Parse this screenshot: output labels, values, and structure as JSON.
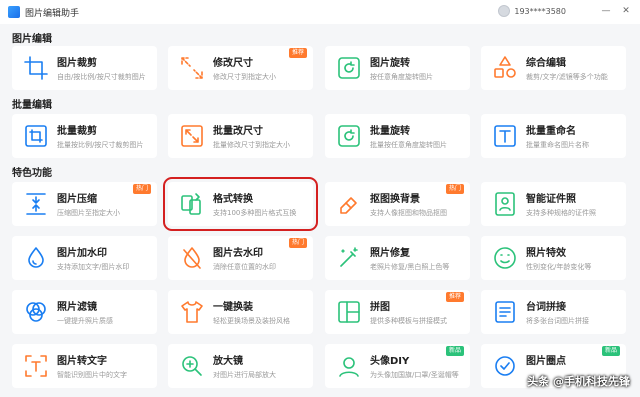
{
  "app": {
    "title": "图片编辑助手",
    "user": "193****3580"
  },
  "window": {
    "minimize": "—",
    "close": "✕"
  },
  "sections": {
    "edit": "图片编辑",
    "batch": "批量编辑",
    "features": "特色功能"
  },
  "cards": {
    "crop": {
      "name": "图片裁剪",
      "desc": "自由/按比例/按尺寸裁剪图片"
    },
    "resize": {
      "name": "修改尺寸",
      "desc": "修改尺寸到指定大小",
      "badge": "推荐"
    },
    "rotate": {
      "name": "图片旋转",
      "desc": "按任意角度旋转图片"
    },
    "combo": {
      "name": "综合编辑",
      "desc": "裁剪/文字/滤镜等多个功能"
    },
    "batch_crop": {
      "name": "批量裁剪",
      "desc": "批量按比例/按尺寸裁剪图片"
    },
    "batch_resize": {
      "name": "批量改尺寸",
      "desc": "批量修改尺寸到指定大小"
    },
    "batch_rotate": {
      "name": "批量旋转",
      "desc": "批量按任意角度旋转图片"
    },
    "batch_rename": {
      "name": "批量重命名",
      "desc": "批量重命名图片名称"
    },
    "compress": {
      "name": "图片压缩",
      "desc": "压缩图片至指定大小",
      "badge": "热门"
    },
    "convert": {
      "name": "格式转换",
      "desc": "支持100多种图片格式互换"
    },
    "matting": {
      "name": "抠图换背景",
      "desc": "支持人像抠图和物品抠图",
      "badge": "热门"
    },
    "id_photo": {
      "name": "智能证件照",
      "desc": "支持多种规格的证件照"
    },
    "watermark_add": {
      "name": "图片加水印",
      "desc": "支持添加文字/图片水印"
    },
    "watermark_remove": {
      "name": "图片去水印",
      "desc": "消除任意位置的水印",
      "badge": "热门"
    },
    "repair": {
      "name": "照片修复",
      "desc": "老照片修复/黑白照上色等"
    },
    "effects": {
      "name": "照片特效",
      "desc": "性别变化/年龄变化等"
    },
    "filter": {
      "name": "照片滤镜",
      "desc": "一键提升照片质感"
    },
    "outfit": {
      "name": "一键换装",
      "desc": "轻松更换场景及装扮风格"
    },
    "puzzle": {
      "name": "拼图",
      "desc": "提供多种模板与拼接模式",
      "badge": "推荐"
    },
    "stitch": {
      "name": "台词拼接",
      "desc": "将多张台词图片拼接"
    },
    "to_text": {
      "name": "图片转文字",
      "desc": "智能识别图片中的文字"
    },
    "magnifier": {
      "name": "放大镜",
      "desc": "对图片进行局部放大"
    },
    "avatar_diy": {
      "name": "头像DIY",
      "desc": "为头像加国旗/口罩/圣诞帽等",
      "badge": "新品"
    },
    "dots": {
      "name": "图片圈点",
      "desc": "",
      "badge": "新品"
    }
  },
  "watermark": "头条 @手机科技先锋",
  "colors": {
    "accent": "#1a7ef2",
    "hot": "#ff7a2e",
    "new": "#2bc27a",
    "highlight": "#d42020"
  }
}
